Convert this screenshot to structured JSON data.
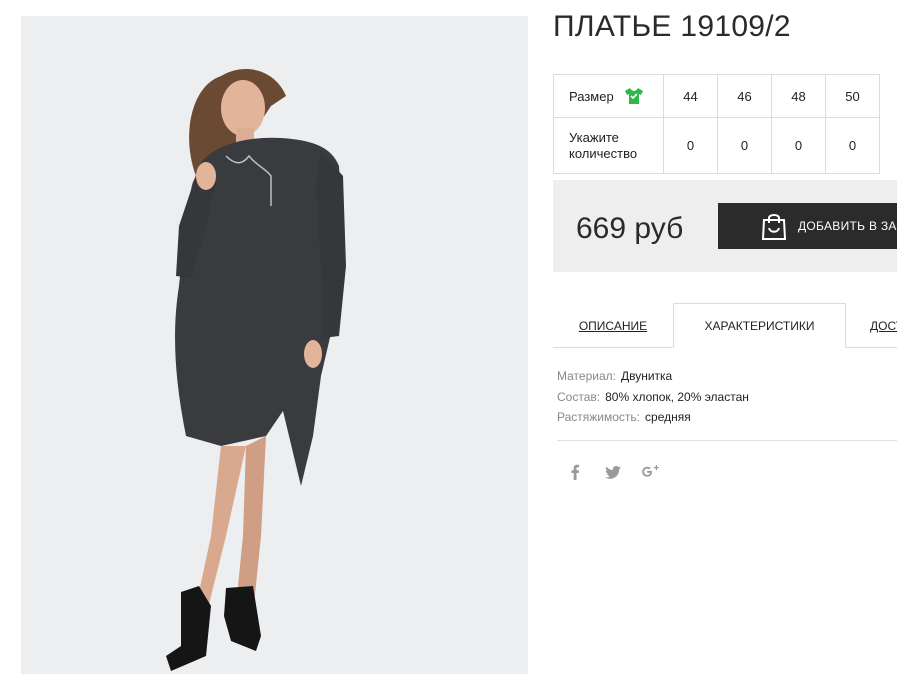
{
  "product": {
    "title": "ПЛАТЬЕ 19109/2"
  },
  "sizes": {
    "size_label": "Размер",
    "qty_label": "Укажите количество",
    "options": [
      {
        "size": "44",
        "qty": "0"
      },
      {
        "size": "46",
        "qty": "0"
      },
      {
        "size": "48",
        "qty": "0"
      },
      {
        "size": "50",
        "qty": "0"
      }
    ]
  },
  "purchase": {
    "price": "669 руб",
    "add_to_cart_label": "ДОБАВИТЬ В ЗА"
  },
  "tabs": [
    {
      "label": "ОПИСАНИЕ"
    },
    {
      "label": "ХАРАКТЕРИСТИКИ",
      "active": true
    },
    {
      "label": "ДОСТ"
    }
  ],
  "specs": [
    {
      "key": "Материал:",
      "value": "Двунитка"
    },
    {
      "key": "Состав:",
      "value": "80% хлопок, 20% эластан"
    },
    {
      "key": "Растяжимость:",
      "value": "средняя"
    }
  ],
  "social": {
    "icons": [
      "facebook-icon",
      "twitter-icon",
      "google-plus-icon"
    ]
  },
  "colors": {
    "accent": "#2b2b2b",
    "size_icon": "#2fb84a",
    "price_box_bg": "#eeeeee",
    "photo_bg": "#eceef0"
  }
}
